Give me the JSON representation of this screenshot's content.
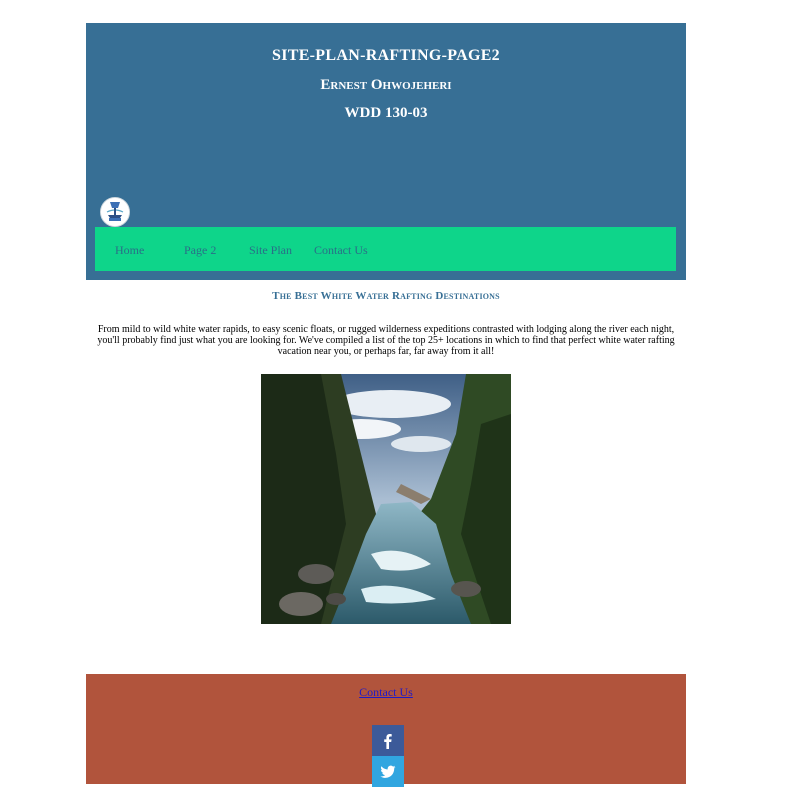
{
  "header": {
    "title": "SITE-PLAN-RAFTING-PAGE2",
    "author": "Ernest Ohwojeheri",
    "course": "WDD 130-03",
    "logo_icon": "rafting-logo-icon"
  },
  "nav": {
    "items": [
      "Home",
      "Page 2",
      "Site Plan",
      "Contact Us"
    ]
  },
  "main": {
    "heading": "The Best White Water Rafting Destinations",
    "intro": "From mild to wild white water rapids, to easy scenic floats, or rugged wilderness expeditions contrasted with lodging along the river each night, you'll probably find just what you are looking for. We've compiled a list of the top 25+ locations in which to find that perfect white water rafting vacation near you, or perhaps far, far away from it all!",
    "photo_icon": "river-photo"
  },
  "footer": {
    "contact_link": "Contact Us",
    "social": [
      "facebook-icon",
      "twitter-icon"
    ]
  },
  "colors": {
    "header_bg": "#376f95",
    "nav_bg": "#0ed58a",
    "footer_bg": "#b1543c",
    "facebook": "#3c5a99",
    "twitter": "#31a6e0"
  }
}
